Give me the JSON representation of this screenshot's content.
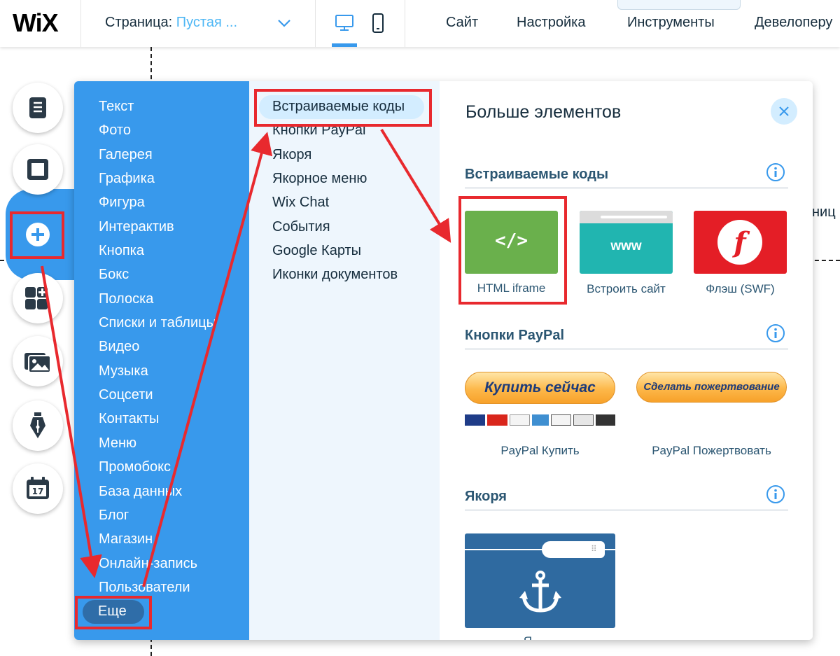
{
  "topbar": {
    "logo": "WiX",
    "page_label": "Страница:",
    "page_value": "Пустая ...",
    "menu": [
      "Сайт",
      "Настройка",
      "Инструменты",
      "Девелоперу"
    ],
    "collapse_tab_glyph": "⌃"
  },
  "canvas": {
    "partial_text": "ниц"
  },
  "left_rail": [
    "pages-icon",
    "background-icon",
    "add-icon",
    "apps-icon",
    "media-icon",
    "blog-pen-icon",
    "bookings-calendar-icon"
  ],
  "add_panel": {
    "categories": [
      "Текст",
      "Фото",
      "Галерея",
      "Графика",
      "Фигура",
      "Интерактив",
      "Кнопка",
      "Бокс",
      "Полоска",
      "Списки и таблицы",
      "Видео",
      "Музыка",
      "Соцсети",
      "Контакты",
      "Меню",
      "Промобокс",
      "База данных",
      "Блог",
      "Магазин",
      "Онлайн-запись",
      "Пользователи"
    ],
    "more_label": "Еще",
    "subcategories": [
      "Встраиваемые коды",
      "Кнопки PayPal",
      "Якоря",
      "Якорное меню",
      "Wix Chat",
      "События",
      "Google Карты",
      "Иконки документов"
    ],
    "title": "Больше элементов",
    "sections": {
      "embeds": {
        "title": "Встраиваемые коды",
        "items": [
          {
            "label": "HTML iframe",
            "glyph": "</>"
          },
          {
            "label": "Встроить сайт",
            "glyph": "www"
          },
          {
            "label": "Флэш (SWF)",
            "glyph": "f"
          }
        ]
      },
      "paypal": {
        "title": "Кнопки PayPal",
        "buy_button": "Купить сейчас",
        "donate_button": "Сделать пожертвование",
        "buy_label": "PayPal Купить",
        "donate_label": "PayPal Пожертвовать"
      },
      "anchors": {
        "title": "Якоря",
        "partial_label": "Я"
      }
    }
  },
  "colors": {
    "primary_blue": "#3899ec",
    "light_blue": "#d3edff",
    "html_green": "#6ab04c",
    "embed_teal": "#21b5b0",
    "flash_red": "#e41e26",
    "anchor_navy": "#2f6aa0",
    "annotation_red": "#e8292e"
  }
}
